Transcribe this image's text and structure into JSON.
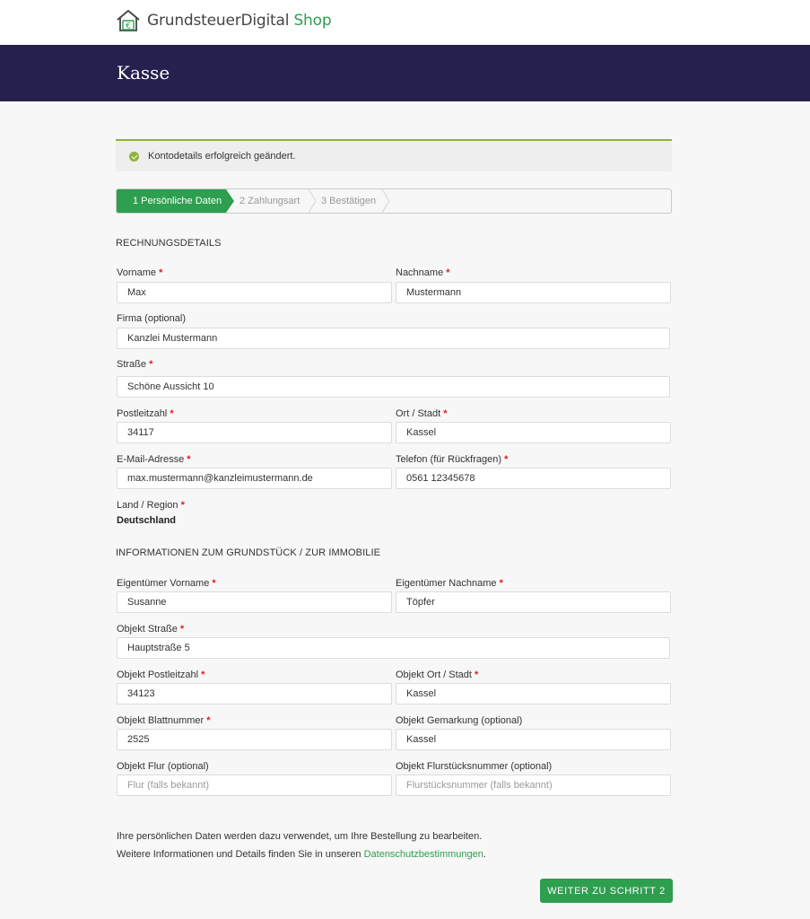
{
  "brand": {
    "name_main": "GrundsteuerDigital",
    "name_accent": "Shop",
    "icon": "house-euro-icon",
    "accent_color": "#2e9e4f"
  },
  "banner": {
    "title": "Kasse",
    "color": "#25204d"
  },
  "notice": {
    "text": "Kontodetails erfolgreich geändert.",
    "icon": "check-circle-icon"
  },
  "steps": [
    {
      "label": "1 Persönliche Daten",
      "active": true
    },
    {
      "label": "2 Zahlungsart",
      "active": false
    },
    {
      "label": "3 Bestätigen",
      "active": false
    }
  ],
  "billing": {
    "title": "RECHNUNGSDETAILS",
    "first_name": {
      "label": "Vorname",
      "value": "Max"
    },
    "last_name": {
      "label": "Nachname",
      "value": "Mustermann"
    },
    "company": {
      "label": "Firma (optional)",
      "value": "Kanzlei Mustermann"
    },
    "street": {
      "label": "Straße",
      "value": "Schöne Aussicht 10"
    },
    "postcode": {
      "label": "Postleitzahl",
      "value": "34117"
    },
    "city": {
      "label": "Ort / Stadt",
      "value": "Kassel"
    },
    "email": {
      "label": "E-Mail-Adresse",
      "value": "max.mustermann@kanzleimustermann.de"
    },
    "phone": {
      "label": "Telefon (für Rückfragen)",
      "value": "0561 12345678"
    },
    "country": {
      "label": "Land / Region",
      "value": "Deutschland"
    }
  },
  "property": {
    "title": "INFORMATIONEN ZUM GRUNDSTÜCK / ZUR IMMOBILIE",
    "owner_first": {
      "label": "Eigentümer Vorname",
      "value": "Susanne"
    },
    "owner_last": {
      "label": "Eigentümer Nachname",
      "value": "Töpfer"
    },
    "street": {
      "label": "Objekt Straße",
      "value": "Hauptstraße 5"
    },
    "postcode": {
      "label": "Objekt Postleitzahl",
      "value": "34123"
    },
    "city": {
      "label": "Objekt Ort / Stadt",
      "value": "Kassel"
    },
    "sheet": {
      "label": "Objekt Blattnummer",
      "value": "2525"
    },
    "district": {
      "label": "Objekt Gemarkung (optional)",
      "value": "Kassel"
    },
    "flur": {
      "label": "Objekt Flur (optional)",
      "value": "",
      "placeholder": "Flur (falls bekannt)"
    },
    "parcel": {
      "label": "Objekt Flurstücksnummer (optional)",
      "value": "",
      "placeholder": "Flurstücksnummer (falls bekannt)"
    }
  },
  "privacy": {
    "line1": "Ihre persönlichen Daten werden dazu verwendet, um Ihre Bestellung zu bearbeiten.",
    "line2_prefix": "Weitere Informationen und Details finden Sie in unseren ",
    "link": "Datenschutzbestimmungen",
    "line2_suffix": "."
  },
  "actions": {
    "next": "Weiter zu Schritt 2"
  },
  "required_mark": "*"
}
